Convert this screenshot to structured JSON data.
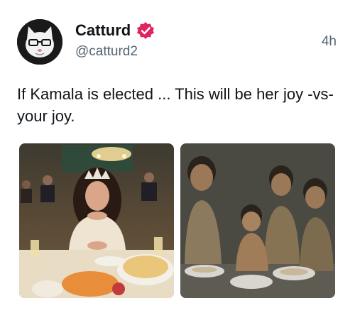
{
  "author": {
    "display_name": "Catturd",
    "handle": "@catturd2",
    "verified_badge_icon": "verified-badge-icon",
    "badge_color": "#e0245e"
  },
  "timestamp": "4h",
  "tweet": {
    "text": "If Kamala is elected ... This will be her joy -vs- your joy."
  },
  "media": [
    {
      "description_icon": "photo-icon",
      "kind": "banquet-scene"
    },
    {
      "description_icon": "photo-icon",
      "kind": "children-scene"
    }
  ]
}
